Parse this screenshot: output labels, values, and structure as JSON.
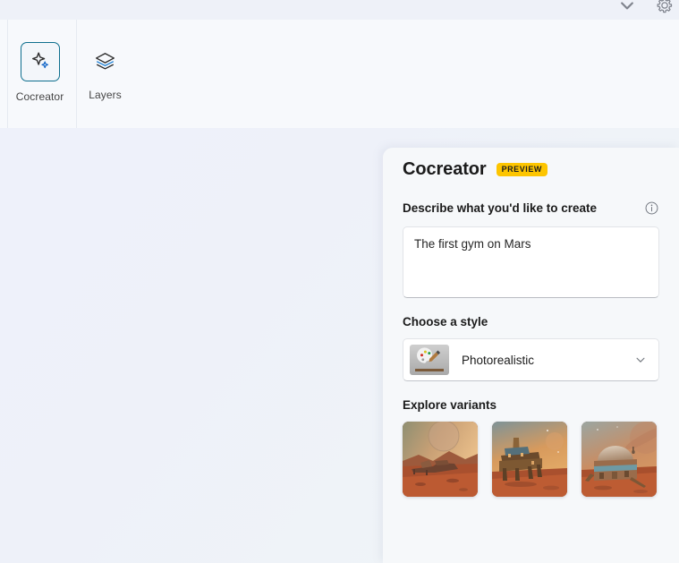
{
  "window": {
    "chrome_icons": [
      "chevron-down-icon",
      "gear-icon"
    ]
  },
  "toolbar": {
    "items": [
      {
        "label": "Cocreator",
        "icon": "sparkle-icon",
        "selected": true
      },
      {
        "label": "Layers",
        "icon": "layers-icon",
        "selected": false
      }
    ]
  },
  "panel": {
    "title": "Cocreator",
    "badge": "PREVIEW",
    "prompt": {
      "label": "Describe what you'd like to create",
      "info_icon": "info-icon",
      "value": "The first gym on Mars",
      "placeholder": "Describe what you'd like to create"
    },
    "style": {
      "label": "Choose a style",
      "selected": "Photorealistic",
      "options": [
        "Photorealistic"
      ],
      "chevron": "chevron-down-icon",
      "thumbnail": "paint-palette-thumbnail"
    },
    "variants": {
      "label": "Explore variants",
      "items": [
        {
          "name": "mars-low-habitat-variant"
        },
        {
          "name": "mars-rig-structure-variant"
        },
        {
          "name": "mars-domed-habitat-variant"
        }
      ]
    }
  },
  "colors": {
    "accent": "#0e6f8e",
    "badge": "#fdc500",
    "panel_bg": "#f6f8fa",
    "toolbar_bg": "#f7f9fc",
    "canvas_bg": "#eef1fa"
  }
}
